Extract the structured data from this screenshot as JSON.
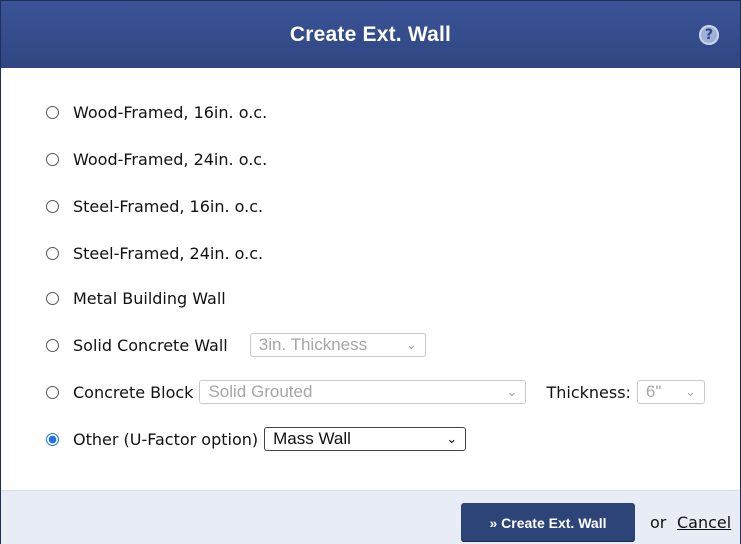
{
  "dialog": {
    "title": "Create Ext. Wall",
    "help_icon": "question-circle-icon",
    "help_glyph": "?"
  },
  "options": [
    {
      "label": "Wood-Framed, 16in. o.c.",
      "checked": false
    },
    {
      "label": "Wood-Framed, 24in. o.c.",
      "checked": false
    },
    {
      "label": "Steel-Framed, 16in. o.c.",
      "checked": false
    },
    {
      "label": "Steel-Framed, 24in. o.c.",
      "checked": false
    },
    {
      "label": "Metal Building Wall",
      "checked": false
    },
    {
      "label": "Solid Concrete Wall",
      "checked": false
    },
    {
      "label": "Concrete Block",
      "checked": false
    },
    {
      "label": "Other (U-Factor option)",
      "checked": true
    }
  ],
  "selects": {
    "solid_concrete_thickness": {
      "value": "3in. Thickness",
      "disabled": true
    },
    "concrete_block_type": {
      "value": "Solid Grouted",
      "disabled": true
    },
    "concrete_block_thickness_label": "Thickness:",
    "concrete_block_thickness": {
      "value": "6\"",
      "disabled": true
    },
    "other_type": {
      "value": "Mass Wall",
      "disabled": false
    }
  },
  "footer": {
    "create_label": "» Create Ext. Wall",
    "or_text": "or",
    "cancel_label": "Cancel"
  },
  "colors": {
    "header_bg": "#2f4682",
    "button_bg": "#2d4479",
    "footer_bg": "#e8edf5",
    "radio_checked": "#1a73e8"
  }
}
